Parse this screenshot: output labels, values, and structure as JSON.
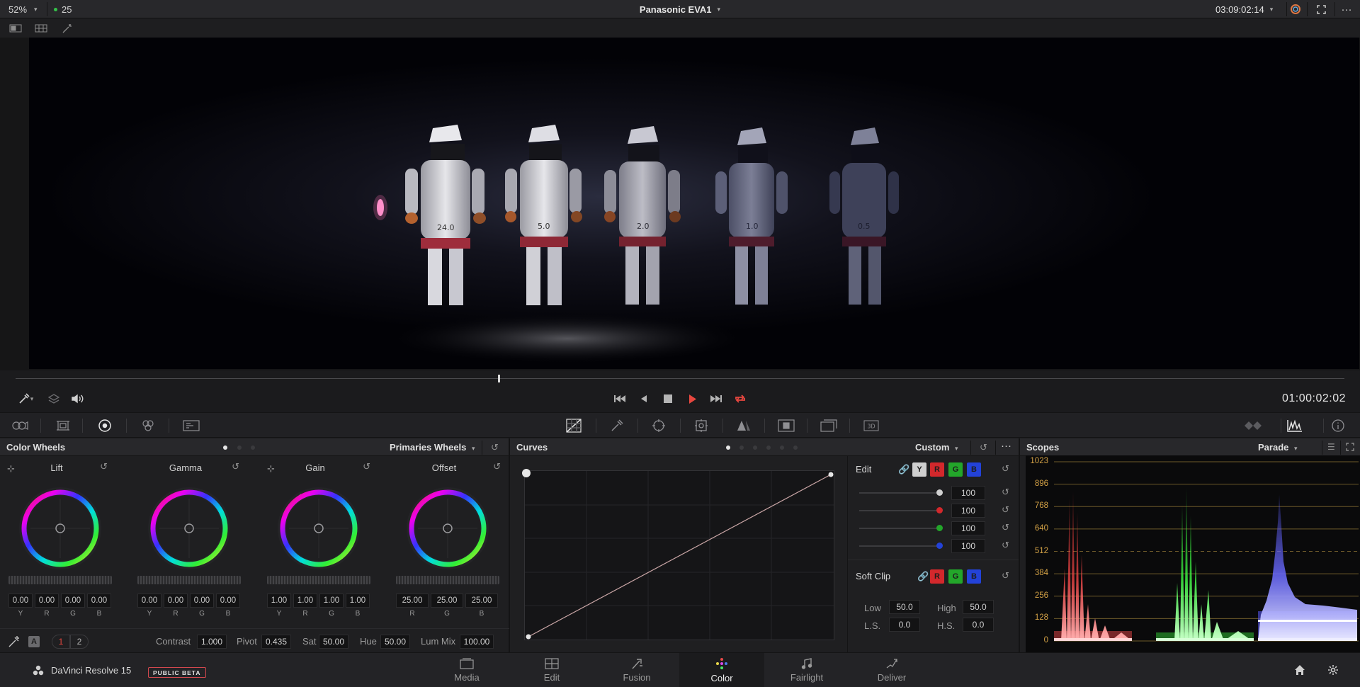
{
  "top": {
    "zoom": "52%",
    "frame_count": "25",
    "clip_name": "Panasonic EVA1",
    "source_timecode": "03:09:02:14"
  },
  "viewer": {
    "figure_labels": [
      "24.0",
      "5.0",
      "2.0",
      "1.0",
      "0.5"
    ]
  },
  "transport": {
    "timecode": "01:00:02:02"
  },
  "color_wheels": {
    "title": "Color Wheels",
    "mode": "Primaries Wheels",
    "wheels": [
      {
        "label": "Lift",
        "values": [
          "0.00",
          "0.00",
          "0.00",
          "0.00"
        ],
        "channels": [
          "Y",
          "R",
          "G",
          "B"
        ]
      },
      {
        "label": "Gamma",
        "values": [
          "0.00",
          "0.00",
          "0.00",
          "0.00"
        ],
        "channels": [
          "Y",
          "R",
          "G",
          "B"
        ]
      },
      {
        "label": "Gain",
        "values": [
          "1.00",
          "1.00",
          "1.00",
          "1.00"
        ],
        "channels": [
          "Y",
          "R",
          "G",
          "B"
        ]
      },
      {
        "label": "Offset",
        "values": [
          "25.00",
          "25.00",
          "25.00"
        ],
        "channels": [
          "R",
          "G",
          "B"
        ]
      }
    ],
    "page_a": "A",
    "page1": "1",
    "page2": "2",
    "contrast_label": "Contrast",
    "contrast": "1.000",
    "pivot_label": "Pivot",
    "pivot": "0.435",
    "sat_label": "Sat",
    "sat": "50.00",
    "hue_label": "Hue",
    "hue": "50.00",
    "lummix_label": "Lum Mix",
    "lummix": "100.00"
  },
  "curves": {
    "title": "Curves",
    "mode": "Custom",
    "edit_label": "Edit",
    "channel_chips": [
      "Y",
      "R",
      "G",
      "B"
    ],
    "intensity": [
      "100",
      "100",
      "100",
      "100"
    ],
    "softclip_label": "Soft Clip",
    "softclip_chips": [
      "R",
      "G",
      "B"
    ],
    "low_label": "Low",
    "low": "50.0",
    "high_label": "High",
    "high": "50.0",
    "ls_label": "L.S.",
    "ls": "0.0",
    "hs_label": "H.S.",
    "hs": "0.0"
  },
  "scopes": {
    "title": "Scopes",
    "mode": "Parade",
    "ticks": [
      "1023",
      "896",
      "768",
      "640",
      "512",
      "384",
      "256",
      "128",
      "0"
    ]
  },
  "app": {
    "name": "DaVinci Resolve 15",
    "badge": "PUBLIC BETA"
  },
  "pages": [
    {
      "label": "Media"
    },
    {
      "label": "Edit"
    },
    {
      "label": "Fusion"
    },
    {
      "label": "Color"
    },
    {
      "label": "Fairlight"
    },
    {
      "label": "Deliver"
    }
  ],
  "colors": {
    "accent": "#e8473f",
    "red_chip": "#d3282c",
    "green_chip": "#23a62a",
    "blue_chip": "#2342d8"
  }
}
